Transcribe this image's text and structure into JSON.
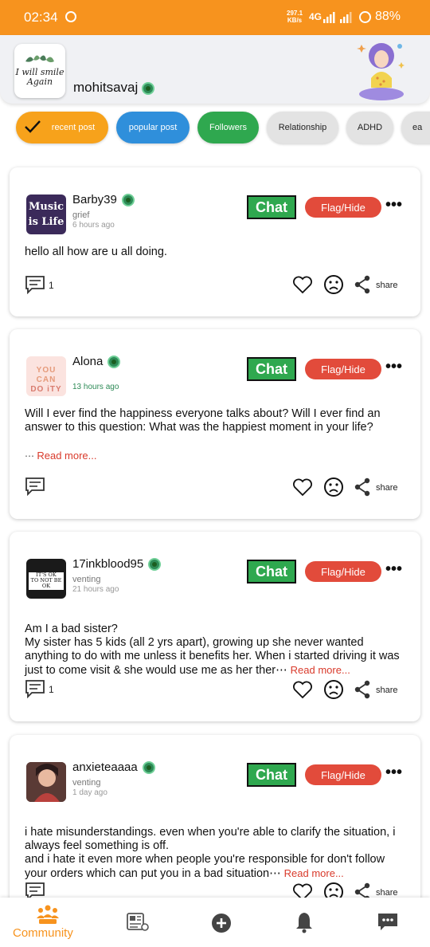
{
  "status_bar": {
    "time": "02:34",
    "speed_value": "297.1",
    "speed_unit": "KB/s",
    "network": "4G",
    "battery": "88%"
  },
  "header": {
    "logo_text_line1": "I will smile",
    "logo_text_line2": "Again",
    "username": "mohitsavaj"
  },
  "tabs": [
    {
      "label": "recent post",
      "bg": "#f7a21b",
      "color": "#ffffff",
      "active": true
    },
    {
      "label": "popular post",
      "bg": "#2f8fdb",
      "color": "#ffffff",
      "active": false
    },
    {
      "label": "Followers",
      "bg": "#2fa84f",
      "color": "#ffffff",
      "active": false
    },
    {
      "label": "Relationship",
      "bg": "#e3e3e3",
      "color": "#222222",
      "active": false
    },
    {
      "label": "ADHD",
      "bg": "#e3e3e3",
      "color": "#222222",
      "active": false
    },
    {
      "label": "ea",
      "bg": "#e3e3e3",
      "color": "#222222",
      "active": false
    }
  ],
  "buttons": {
    "chat": "Chat",
    "flag": "Flag/Hide",
    "share": "share",
    "read_more": "Read more..."
  },
  "posts": [
    {
      "username": "Barby39",
      "category": "grief",
      "time": "6 hours ago",
      "avatar_text_1": "Music",
      "avatar_text_2": "is Life",
      "body": "hello all how are u all doing.",
      "comment_count": "1"
    },
    {
      "username": "Alona",
      "category": "",
      "time": "13 hours ago",
      "avatar_text_1": "YOU CAN",
      "avatar_text_2": "DO iTY",
      "body": "Will I ever find the happiness everyone talks about? Will I ever find an answer to this question: What was the happiest moment in your life?",
      "comment_count": ""
    },
    {
      "username": "17inkblood95",
      "category": "venting",
      "time": "21 hours ago",
      "avatar_text_1": "IT'S OK",
      "avatar_text_2": "TO NOT BE OK",
      "body": "Am I a bad sister?\nMy sister has 5 kids (all 2 yrs apart), growing up she never wanted anything to do with me unless it benefits her. When i started driving it was just to come visit & she would use me as her ther⋯",
      "comment_count": "1"
    },
    {
      "username": "anxieteaaaa",
      "category": "venting",
      "time": "1 day ago",
      "avatar_text_1": "",
      "avatar_text_2": "",
      "body": "i hate misunderstandings. even when you're able to clarify the situation, i always feel something is off.\nand i hate it even more when people you're responsible for don't follow your orders which can put you in a bad situation⋯",
      "comment_count": ""
    }
  ],
  "bottom_nav": {
    "community_label": "Community",
    "active_color": "#f7931e"
  },
  "icons": [
    "check-icon",
    "verified-icon",
    "comment-icon",
    "heart-icon",
    "sad-face-icon",
    "share-icon",
    "more-icon",
    "community-icon",
    "news-icon",
    "add-icon",
    "bell-icon",
    "chat-icon"
  ]
}
